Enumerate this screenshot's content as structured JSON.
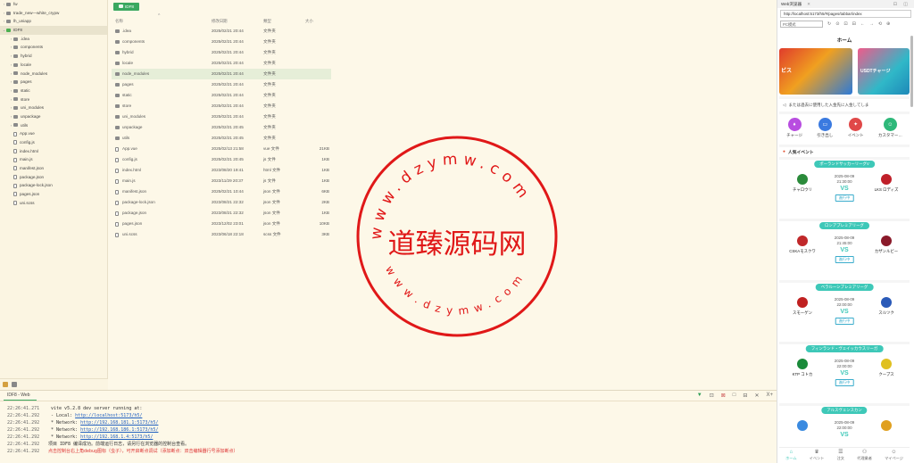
{
  "sidebar": {
    "items": [
      {
        "label": "fw",
        "type": "folder",
        "level": 0,
        "arrow": "›"
      },
      {
        "label": "trade_new—white_crypw",
        "type": "folder",
        "level": 0,
        "arrow": "›"
      },
      {
        "label": "lh_uniapp",
        "type": "folder",
        "level": 0,
        "arrow": "›"
      },
      {
        "label": "IDF8",
        "type": "folder",
        "level": 0,
        "arrow": "⌄",
        "green": true,
        "selected": true
      },
      {
        "label": ".idea",
        "type": "folder",
        "level": 1,
        "arrow": "›"
      },
      {
        "label": "components",
        "type": "folder",
        "level": 1,
        "arrow": "›"
      },
      {
        "label": "hybrid",
        "type": "folder",
        "level": 1,
        "arrow": "›"
      },
      {
        "label": "locale",
        "type": "folder",
        "level": 1,
        "arrow": "›"
      },
      {
        "label": "node_modules",
        "type": "folder",
        "level": 1,
        "arrow": "›"
      },
      {
        "label": "pages",
        "type": "folder",
        "level": 1,
        "arrow": "›"
      },
      {
        "label": "static",
        "type": "folder",
        "level": 1,
        "arrow": "›"
      },
      {
        "label": "store",
        "type": "folder",
        "level": 1,
        "arrow": "›"
      },
      {
        "label": "uni_modules",
        "type": "folder",
        "level": 1,
        "arrow": "›"
      },
      {
        "label": "unpackage",
        "type": "folder",
        "level": 1,
        "arrow": "›"
      },
      {
        "label": "utils",
        "type": "folder",
        "level": 1,
        "arrow": "›"
      },
      {
        "label": "App.vue",
        "type": "file",
        "level": 1,
        "arrow": ""
      },
      {
        "label": "config.js",
        "type": "file",
        "level": 1,
        "arrow": ""
      },
      {
        "label": "index.html",
        "type": "file",
        "level": 1,
        "arrow": ""
      },
      {
        "label": "main.js",
        "type": "file",
        "level": 1,
        "arrow": ""
      },
      {
        "label": "manifest.json",
        "type": "file",
        "level": 1,
        "arrow": ""
      },
      {
        "label": "package.json",
        "type": "file",
        "level": 1,
        "arrow": ""
      },
      {
        "label": "package-lock.json",
        "type": "file",
        "level": 1,
        "arrow": ""
      },
      {
        "label": "pages.json",
        "type": "file",
        "level": 1,
        "arrow": ""
      },
      {
        "label": "uni.scss",
        "type": "file",
        "level": 1,
        "arrow": ""
      }
    ]
  },
  "explorer": {
    "path_button": "IDF8",
    "columns": {
      "name": "名称",
      "date": "修改日期",
      "type": "類型",
      "size": "大小"
    },
    "sort_indicator": "^",
    "rows": [
      {
        "name": ".idea",
        "date": "2025/02/21 20:44",
        "type": "文件夹",
        "size": "",
        "kind": "folder"
      },
      {
        "name": "components",
        "date": "2025/02/21 20:44",
        "type": "文件夹",
        "size": "",
        "kind": "folder"
      },
      {
        "name": "hybrid",
        "date": "2025/02/21 20:44",
        "type": "文件夹",
        "size": "",
        "kind": "folder"
      },
      {
        "name": "locale",
        "date": "2025/02/21 20:44",
        "type": "文件夹",
        "size": "",
        "kind": "folder"
      },
      {
        "name": "node_modules",
        "date": "2025/02/21 20:44",
        "type": "文件夹",
        "size": "",
        "kind": "folder",
        "highlight": true
      },
      {
        "name": "pages",
        "date": "2025/02/21 20:44",
        "type": "文件夹",
        "size": "",
        "kind": "folder"
      },
      {
        "name": "static",
        "date": "2025/02/21 20:44",
        "type": "文件夹",
        "size": "",
        "kind": "folder"
      },
      {
        "name": "store",
        "date": "2025/02/21 20:44",
        "type": "文件夹",
        "size": "",
        "kind": "folder"
      },
      {
        "name": "uni_modules",
        "date": "2025/02/21 20:44",
        "type": "文件夹",
        "size": "",
        "kind": "folder"
      },
      {
        "name": "unpackage",
        "date": "2025/02/21 20:45",
        "type": "文件夹",
        "size": "",
        "kind": "folder"
      },
      {
        "name": "utils",
        "date": "2025/02/21 20:45",
        "type": "文件夹",
        "size": "",
        "kind": "folder"
      },
      {
        "name": "App.vue",
        "date": "2025/02/13 21:58",
        "type": "vue 文件",
        "size": "21KB",
        "kind": "file"
      },
      {
        "name": "config.js",
        "date": "2025/02/21 20:45",
        "type": "js 文件",
        "size": "1KB",
        "kind": "file"
      },
      {
        "name": "index.html",
        "date": "2023/08/20 19:41",
        "type": "html 文件",
        "size": "1KB",
        "kind": "file"
      },
      {
        "name": "main.js",
        "date": "2023/11/29 20:37",
        "type": "js 文件",
        "size": "1KB",
        "kind": "file"
      },
      {
        "name": "manifest.json",
        "date": "2025/02/21 10:44",
        "type": "json 文件",
        "size": "6KB",
        "kind": "file"
      },
      {
        "name": "package-lock.json",
        "date": "2023/08/21 22:32",
        "type": "json 文件",
        "size": "2KB",
        "kind": "file"
      },
      {
        "name": "package.json",
        "date": "2023/08/21 22:32",
        "type": "json 文件",
        "size": "1KB",
        "kind": "file"
      },
      {
        "name": "pages.json",
        "date": "2023/12/02 23:01",
        "type": "json 文件",
        "size": "10KB",
        "kind": "file"
      },
      {
        "name": "uni.scss",
        "date": "2023/06/18 22:18",
        "type": "scss 文件",
        "size": "3KB",
        "kind": "file"
      }
    ]
  },
  "watermark": {
    "center_text": "道臻源码网",
    "top_arc": "www.dzymw.com",
    "bottom_arc": "www.dzymw.com",
    "color": "#e01818"
  },
  "console": {
    "tab": "IDF8 - Web",
    "tools": [
      "▼",
      "⊡",
      "⊠",
      "□",
      "⊟",
      "✕",
      "X+"
    ],
    "lines": [
      {
        "ts": "22:26:41.271",
        "text": "  vite v5.2.8 dev server running at:",
        "link": ""
      },
      {
        "ts": "22:26:41.292",
        "text": "  - Local:   ",
        "link": "http://localhost:5173/h5/"
      },
      {
        "ts": "22:26:41.292",
        "text": "  * Network: ",
        "link": "http://192.168.181.1:5173/h5/"
      },
      {
        "ts": "22:26:41.292",
        "text": "  * Network: ",
        "link": "http://192.168.186.1:5173/h5/"
      },
      {
        "ts": "22:26:41.292",
        "text": "  * Network: ",
        "link": "http://192.168.1.4:5173/h5/"
      },
      {
        "ts": "22:26:41.292",
        "text": "项目 IDF8 编译成功。前端运行日志，请另行在浏览器的控制台查看。",
        "link": ""
      },
      {
        "ts": "22:26:41.292",
        "text": "点击控制台右上角debug图标（虫子），可开启断点调试（添加断点：双击编辑器行号添加断点）",
        "link": "",
        "red": true
      }
    ]
  },
  "webview": {
    "title": "Web浏览器",
    "close": "✕",
    "tools": "⊡ ◫",
    "url": "http://localhost:5173/h5/#/pages/tabbar/index",
    "mode": "PC模式",
    "nav_icons": [
      "↻",
      "⊙",
      "⊡",
      "⊟",
      "←",
      "→",
      "⟲",
      "⊕"
    ],
    "app": {
      "title": "ホーム",
      "banner_text_1": "ビス",
      "banner_text_2": "USDTチャージ",
      "notice": "または過去に使用した入金先に入金してしま",
      "quick": [
        {
          "label": "チャージ",
          "color": "#b84de0",
          "icon": "♦"
        },
        {
          "label": "引き出し",
          "color": "#3a7ae0",
          "icon": "▭"
        },
        {
          "label": "イベント",
          "color": "#e04848",
          "icon": "✦"
        },
        {
          "label": "カスタマー…",
          "color": "#2eb87a",
          "icon": "☺"
        }
      ],
      "popular_title": "人気イベント",
      "matches": [
        {
          "league": "ポーランドサッカーリーグV",
          "date": "2025-08-09",
          "time": "21:30:00",
          "home": "チャロウリ",
          "away": "LKS ロディズ",
          "status": "進行中",
          "home_color": "#2a8a3a",
          "away_color": "#c0202a"
        },
        {
          "league": "ロシアプレミアリーグ",
          "date": "2025-08-09",
          "time": "21:45:00",
          "home": "CSKAモスクワ",
          "away": "カザンルビー",
          "status": "進行中",
          "home_color": "#c0282a",
          "away_color": "#8a1a2a"
        },
        {
          "league": "ベラルーシプレミアリーグ",
          "date": "2025-08-09",
          "time": "22:00:00",
          "home": "スモーゲン",
          "away": "スルツク",
          "status": "進行中",
          "home_color": "#c02020",
          "away_color": "#2a5ab8"
        },
        {
          "league": "フィンランド・ヴェイッカウスリーガ",
          "date": "2025-08-09",
          "time": "22:00:00",
          "home": "KTP コトカ",
          "away": "クープス",
          "status": "進行中",
          "home_color": "#1a8a3a",
          "away_color": "#e0c020"
        },
        {
          "league": "アルスヴェンスカン",
          "date": "2025-08-09",
          "time": "22:00:00",
          "home": "",
          "away": "",
          "status": "",
          "home_color": "#3a8ae0",
          "away_color": "#e0a020"
        }
      ],
      "vs": "VS",
      "tabs": [
        {
          "label": "ホーム",
          "icon": "⌂",
          "active": true
        },
        {
          "label": "イベント",
          "icon": "♛",
          "active": false
        },
        {
          "label": "注文",
          "icon": "☰",
          "active": false
        },
        {
          "label": "代理業者",
          "icon": "⚇",
          "active": false
        },
        {
          "label": "マイページ",
          "icon": "☺",
          "active": false
        }
      ]
    }
  }
}
